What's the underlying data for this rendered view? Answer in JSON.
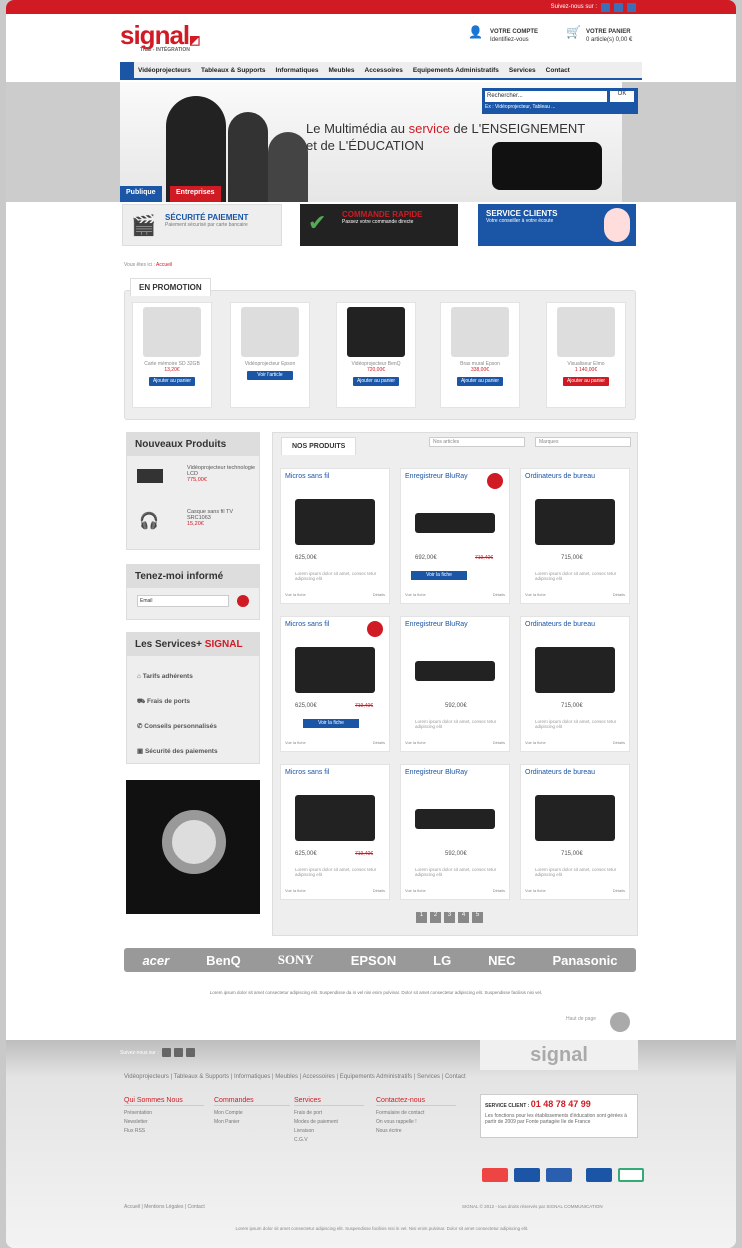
{
  "topbar": {
    "follow": "Suivez-nous sur :"
  },
  "header": {
    "logo": "signal",
    "logo_sub": "TICE - INTÉGRATION",
    "account_title": "VOTRE COMPTE",
    "account_sub": "Identifiez-vous",
    "cart_title": "VOTRE PANIER",
    "cart_sub": "0 article(s) 0,00 €"
  },
  "nav": [
    "Vidéoprojecteurs",
    "Tableaux & Supports",
    "Informatiques",
    "Meubles",
    "Accessoires",
    "Equipements Administratifs",
    "Services",
    "Contact"
  ],
  "search": {
    "placeholder": "Rechercher...",
    "button": "OK",
    "hint": "Ex : Vidéoprojecteur, Tableau ..."
  },
  "hero": {
    "line1_a": "Le Multimédia au ",
    "line1_b": "service",
    "line1_c": " de L'ENSEIGNEMENT",
    "line2": "et de L'ÉDUCATION"
  },
  "tabs": {
    "public": "Publique",
    "enterprise": "Entreprises"
  },
  "promos": [
    {
      "title": "SÉCURITÉ PAIEMENT",
      "sub": "Paiement sécurisé par carte bancaire"
    },
    {
      "title": "COMMANDE RAPIDE",
      "sub": "Passez votre commande directe"
    },
    {
      "title": "SERVICE CLIENTS",
      "sub": "Votre conseiller à votre écoute"
    }
  ],
  "breadcrumb": {
    "a": "Vous êtes ici :",
    "b": "Accueil"
  },
  "promotion": {
    "title": "EN PROMOTION",
    "items": [
      {
        "name": "Carte mémoire SD 32GB",
        "price": "13,20€",
        "btn": "Ajouter au panier"
      },
      {
        "name": "Vidéoprojecteur Epson",
        "price": "",
        "btn": "Voir l'article"
      },
      {
        "name": "Vidéoprojecteur BenQ",
        "price": "720,00€",
        "btn": "Ajouter au panier"
      },
      {
        "name": "Bras mural Epson",
        "price": "338,00€",
        "btn": "Ajouter au panier"
      },
      {
        "name": "Visualiseur Elmo",
        "price": "1 140,00€",
        "btn": "Ajouter au panier"
      }
    ]
  },
  "nouveaux": {
    "title": "Nouveaux Produits",
    "items": [
      {
        "name": "Vidéoprojecteur technologie LCD",
        "price": "775,00€"
      },
      {
        "name": "Casque sans fil TV SRC1063",
        "price": "15,20€"
      }
    ]
  },
  "newsletter": {
    "title": "Tenez-moi informé",
    "placeholder": "Email"
  },
  "services": {
    "title_a": "Les Services+ ",
    "title_b": "SIGNAL",
    "items": [
      "Tarifs adhérents",
      "Frais de ports",
      "Conseils personnalisés",
      "Sécurité des paiements"
    ]
  },
  "produits": {
    "title": "NOS PRODUITS",
    "filter1": "Nos articles",
    "filter2": "Marques",
    "cards": [
      {
        "title": "Micros sans fil",
        "price": "625,00€",
        "old": "",
        "desc": "Lorem ipsum dolor sit amet, consec tetur adipiscing elit",
        "more": "Voir la fiche",
        "detail": "Détails"
      },
      {
        "title": "Enregistreur BluRay",
        "price": "692,00€",
        "old": "719,40€",
        "desc": "",
        "more": "Voir la fiche",
        "detail": "Détails"
      },
      {
        "title": "Ordinateurs de bureau",
        "price": "715,00€",
        "old": "",
        "desc": "Lorem ipsum dolor sit amet, consec tetur adipiscing elit",
        "more": "Voir la fiche",
        "detail": "Détails"
      },
      {
        "title": "Micros sans fil",
        "price": "625,00€",
        "old": "719,40€",
        "desc": "",
        "more": "Voir la fiche",
        "detail": "Détails"
      },
      {
        "title": "Enregistreur BluRay",
        "price": "592,00€",
        "old": "",
        "desc": "Lorem ipsum dolor sit amet, consec tetur adipiscing elit",
        "more": "Voir la fiche",
        "detail": "Détails"
      },
      {
        "title": "Ordinateurs de bureau",
        "price": "715,00€",
        "old": "",
        "desc": "Lorem ipsum dolor sit amet, consec tetur adipiscing elit",
        "more": "Voir la fiche",
        "detail": "Détails"
      },
      {
        "title": "Micros sans fil",
        "price": "625,00€",
        "old": "719,40€",
        "desc": "Lorem ipsum dolor sit amet, consec tetur adipiscing elit",
        "more": "Voir la fiche",
        "detail": "Détails"
      },
      {
        "title": "Enregistreur BluRay",
        "price": "592,00€",
        "old": "",
        "desc": "Lorem ipsum dolor sit amet, consec tetur adipiscing elit",
        "more": "Voir la fiche",
        "detail": "Détails"
      },
      {
        "title": "Ordinateurs de bureau",
        "price": "715,00€",
        "old": "",
        "desc": "Lorem ipsum dolor sit amet, consec tetur adipiscing elit",
        "more": "Voir la fiche",
        "detail": "Détails"
      }
    ],
    "add_btn": "Voir la fiche",
    "pagination": [
      "1",
      "2",
      "3",
      "4",
      "5"
    ]
  },
  "brands": [
    "acer",
    "BenQ",
    "SONY",
    "EPSON",
    "LG",
    "NEC",
    "Panasonic"
  ],
  "legal": "Lorem ipsum dolor sit amet consectetur adipiscing elit. Suspendisse da in vel nisi enim pulvinar. Dolor sit amet consectetur adipiscing elit. Suspendisse facilisis nisi vel.",
  "scroll_top": "Haut de page",
  "footer": {
    "follow": "Suivez-nous sur :",
    "logo": "signal",
    "nav": [
      "Vidéoprojecteurs",
      "Tableaux & Supports",
      "Informatiques",
      "Meubles",
      "Accessoires",
      "Equipements Administratifs",
      "Services",
      "Contact"
    ],
    "cols": [
      {
        "title": "Qui Sommes Nous",
        "items": [
          "Présentation",
          "Newsletter",
          "Flux RSS"
        ]
      },
      {
        "title": "Commandes",
        "items": [
          "Mon Compte",
          "Mon Panier"
        ]
      },
      {
        "title": "Services",
        "items": [
          "Frais de port",
          "Modes de paiement",
          "Livraison",
          "C.G.V"
        ]
      },
      {
        "title": "Contactez-nous",
        "items": [
          "Formulaire de contact",
          "On vous rappelle !",
          "Nous écrire"
        ]
      }
    ],
    "service_label": "SERVICE CLIENT :",
    "service_phone": "01 48 78 47 99",
    "service_text": "Les fonctions pour les établissements d'éducation sont gérées à partir de 2009 par Fonte partagée Ile de France",
    "bottom": [
      "Accueil",
      "Mentions Légales",
      "Contact"
    ],
    "copyright": "SIGNAL © 2012 - tous droits réservés par SIGNAL COMMUNICATION",
    "legal2": "Lorem ipsum dolor sit amet consectetur adipiscing elit. Suspendisse facilisis nisi in vel. Nisi enim pulvinar. Dolor sit amet consectetur adipiscing elit."
  },
  "colors": {
    "red": "#d01a24",
    "blue": "#1a55a6"
  }
}
